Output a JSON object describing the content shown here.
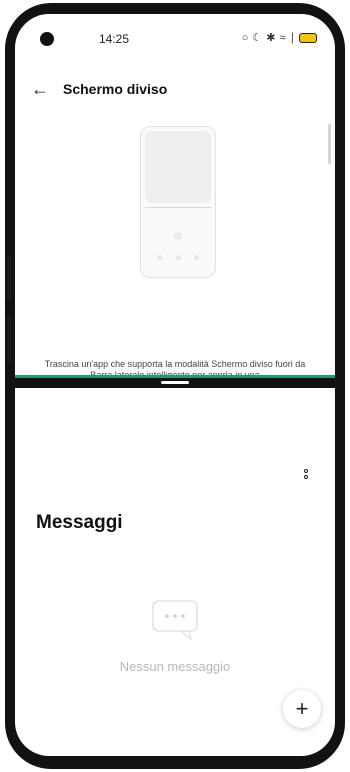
{
  "status_bar": {
    "time": "14:25",
    "icons": [
      "alarm-icon",
      "do-not-disturb-icon",
      "bluetooth-icon",
      "wifi-icon",
      "signal-icon",
      "battery-icon"
    ]
  },
  "settings": {
    "title": "Schermo diviso",
    "back_icon": "arrow-left-icon",
    "help_text": "Trascina un'app che supporta la modalità Schermo diviso fuori da Barra laterale intelligente per aprirla in una"
  },
  "messages": {
    "title": "Messaggi",
    "empty_text": "Nessun messaggio",
    "fab_label": "+",
    "more_icon": "more-vertical-icon"
  },
  "colors": {
    "divider_accent": "#1e9e6d",
    "battery": "#f1c40f"
  }
}
